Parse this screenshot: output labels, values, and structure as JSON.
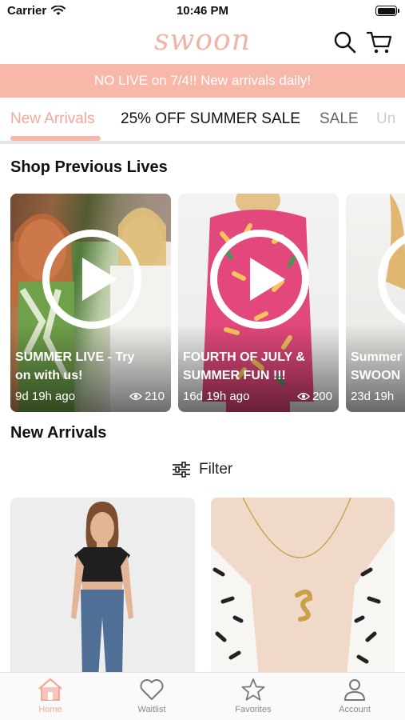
{
  "status_bar": {
    "carrier": "Carrier",
    "time": "10:46 PM"
  },
  "header": {
    "logo": "swoon"
  },
  "banner": {
    "text": "NO LIVE on 7/4!! New arrivals daily!"
  },
  "tabs": [
    "New Arrivals",
    "25% OFF SUMMER SALE",
    "SALE",
    "Un"
  ],
  "sections": {
    "previous_lives": "Shop Previous Lives",
    "new_arrivals": "New Arrivals"
  },
  "lives": [
    {
      "title_line1": "SUMMER LIVE - Try",
      "title_line2": "on with us!",
      "ago": "9d 19h ago",
      "views": "210"
    },
    {
      "title_line1": "FOURTH OF JULY &",
      "title_line2": "SUMMER FUN !!!",
      "ago": "16d 19h ago",
      "views": "200"
    },
    {
      "title_line1": "Summer",
      "title_line2": "SWOON",
      "ago": "23d 19h",
      "views": ""
    }
  ],
  "filter": {
    "label": "Filter"
  },
  "bottom_nav": [
    {
      "label": "Home",
      "icon": "home-icon"
    },
    {
      "label": "Waitlist",
      "icon": "heart-icon"
    },
    {
      "label": "Favorites",
      "icon": "star-icon"
    },
    {
      "label": "Account",
      "icon": "person-icon"
    }
  ],
  "colors": {
    "brand": "#f7b7a9",
    "accent": "#f2a899"
  }
}
